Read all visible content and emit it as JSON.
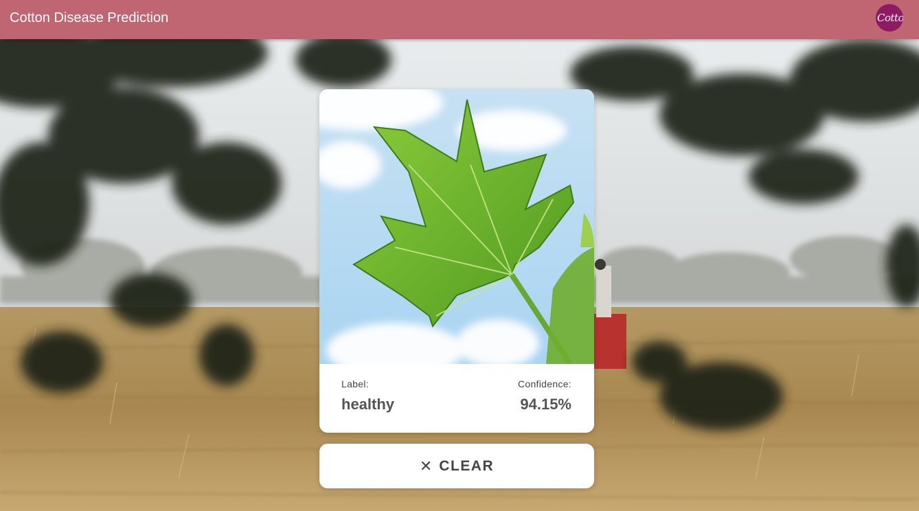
{
  "appbar": {
    "title": "Cotton Disease Prediction",
    "avatar_text": "Cotton",
    "color": "#c06672",
    "avatar_color": "#8e1a64"
  },
  "result": {
    "label_caption": "Label:",
    "label_value": "healthy",
    "confidence_caption": "Confidence:",
    "confidence_value": "94.15%"
  },
  "actions": {
    "clear_icon": "close-icon",
    "clear_label": "CLEAR"
  }
}
